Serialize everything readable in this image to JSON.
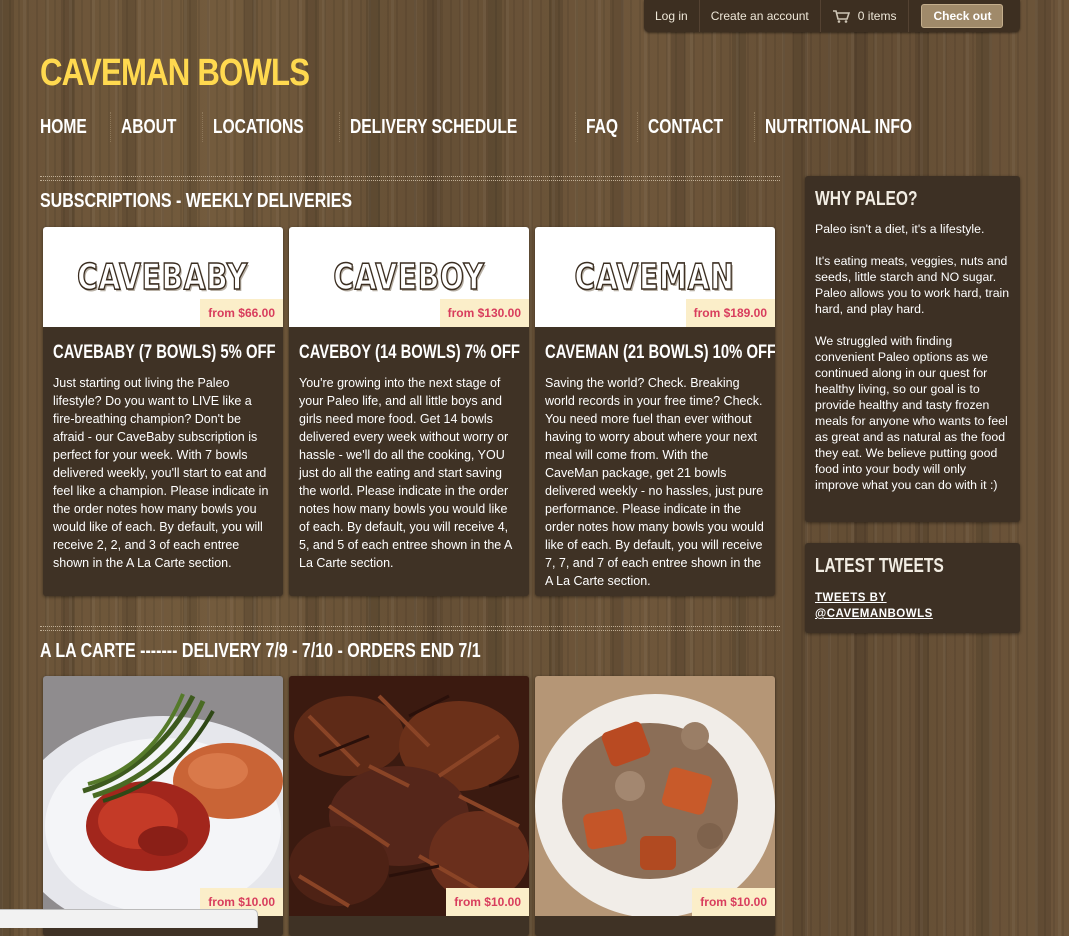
{
  "topbar": {
    "login": "Log in",
    "create_account": "Create an account",
    "cart_count": "0 items",
    "checkout": "Check out"
  },
  "site_title": "CAVEMAN BOWLS",
  "nav": [
    "HOME",
    "ABOUT",
    "LOCATIONS",
    "DELIVERY SCHEDULE",
    "FAQ",
    "CONTACT",
    "NUTRITIONAL INFO"
  ],
  "subscriptions": {
    "title": "SUBSCRIPTIONS - WEEKLY DELIVERIES",
    "products": [
      {
        "logo": "CAVEBABY",
        "price": "from $66.00",
        "name": "CAVEBABY (7 BOWLS) 5% OFF",
        "description": "Just starting out living the Paleo lifestyle? Do you want to LIVE like a fire-breathing champion? Don't be afraid - our CaveBaby subscription is perfect for your week. With 7 bowls delivered weekly, you'll start to eat and feel like a champion.  Please indicate in the order notes how many bowls you would like of each. By default, you will receive 2, 2, and 3 of each entree shown in the A La Carte section."
      },
      {
        "logo": "CAVEBOY",
        "price": "from $130.00",
        "name": "CAVEBOY (14 BOWLS) 7% OFF",
        "description": "You're growing into the next stage of your Paleo life, and all little boys and girls need more food. Get 14 bowls delivered every week without worry or hassle - we'll do all the cooking, YOU just do all the eating and start saving the world. Please indicate in the order notes how many bowls you would like of each. By default, you will receive 4, 5, and 5 of each entree shown in the A La Carte section."
      },
      {
        "logo": "CAVEMAN",
        "price": "from $189.00",
        "name": "CAVEMAN (21 BOWLS) 10% OFF",
        "description": "Saving the world? Check. Breaking world records in your free time? Check. You need more fuel than ever without having to worry about where your next meal will come from. With the CaveMan package, get 21 bowls delivered weekly - no hassles, just pure performance.  Please indicate in the order notes how many bowls you would like of each. By default, you will receive 7, 7, and 7 of each entree shown in the A La Carte section."
      }
    ]
  },
  "alacarte": {
    "title": "A LA CARTE ------- DELIVERY 7/9 - 7/10 - ORDERS END 7/1",
    "products": [
      {
        "price": "from $10.00"
      },
      {
        "price": "from $10.00"
      },
      {
        "price": "from $10.00"
      }
    ]
  },
  "sidebar": {
    "why": {
      "title": "WHY PALEO?",
      "paragraphs": [
        "Paleo isn't a diet, it's a lifestyle.",
        "It's eating meats, veggies, nuts and seeds, little starch and NO sugar. Paleo allows you to work hard, train hard, and play hard.",
        "We struggled with finding convenient Paleo options as we continued along in our quest for healthy living, so our goal is to provide healthy and tasty frozen meals for anyone who wants to feel as great and as natural as the food they eat. We believe putting good food into your body will only improve what you can do with it :)"
      ]
    },
    "tweets": {
      "title": "LATEST TWEETS",
      "link": "TWEETS BY @CAVEMANBOWLS"
    }
  }
}
